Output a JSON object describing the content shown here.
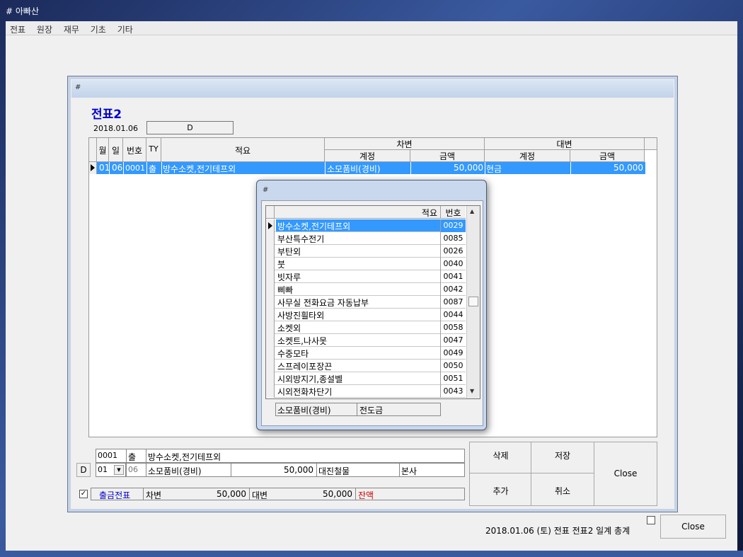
{
  "window": {
    "title": "# 아빠산"
  },
  "menu": [
    "전표",
    "원장",
    "재무",
    "기초",
    "기타"
  ],
  "form": {
    "caption": "#",
    "heading": "전표2",
    "date": "2018.01.06",
    "d_label": "D",
    "grid": {
      "headers": {
        "month": "월",
        "day": "일",
        "number": "번호",
        "type": "TY",
        "memo": "적요",
        "debit": "차변",
        "credit": "대변",
        "debit_account": "계정",
        "debit_amount": "금액",
        "credit_account": "계정",
        "credit_amount": "금액"
      },
      "rows": [
        {
          "month": "01",
          "day": "06",
          "number": "0001",
          "type": "출",
          "memo": "방수소켓,전기테프외",
          "debit_account": "소모품비(경비)",
          "debit_amount": "50,000",
          "credit_account": "현금",
          "credit_amount": "50,000"
        }
      ]
    }
  },
  "popup": {
    "caption": "#",
    "col_memo": "적요",
    "col_number": "번호",
    "items": [
      {
        "memo": "방수소켓,전기테프외",
        "number": "0029"
      },
      {
        "memo": "부산특수전기",
        "number": "0085"
      },
      {
        "memo": "부탄외",
        "number": "0026"
      },
      {
        "memo": "붓",
        "number": "0040"
      },
      {
        "memo": "빗자루",
        "number": "0041"
      },
      {
        "memo": "삐빠",
        "number": "0042"
      },
      {
        "memo": "사무실 전화요금 자동납부",
        "number": "0087"
      },
      {
        "memo": "사방진흴타외",
        "number": "0044"
      },
      {
        "memo": "소켓외",
        "number": "0058"
      },
      {
        "memo": "소켓트,나사못",
        "number": "0047"
      },
      {
        "memo": "수중모타",
        "number": "0049"
      },
      {
        "memo": "스프레이포장끈",
        "number": "0050"
      },
      {
        "memo": "시외방지기,종설벨",
        "number": "0051"
      },
      {
        "memo": "시외전화차단기",
        "number": "0043"
      }
    ],
    "footer_account": "소모품비(경비)",
    "footer_vendor": "전도금"
  },
  "entry": {
    "number": "0001",
    "type": "출",
    "memo": "방수소켓,전기테프외",
    "d_button": "D",
    "month_select": "01",
    "day": "06",
    "account": "소모품비(경비)",
    "amount": "50,000",
    "vendor": "대진철물",
    "branch": "본사",
    "checkbox_mark": "✓",
    "voucher_type": "출금전표",
    "debit_label": "차변",
    "debit_total": "50,000",
    "credit_label": "대변",
    "credit_total": "50,000",
    "balance_label": "잔액"
  },
  "buttons": {
    "delete": "삭제",
    "save": "저장",
    "add": "추가",
    "cancel": "취소",
    "close_form": "Close"
  },
  "status": {
    "summary": "2018.01.06 (토) 전표 전표2 일계 총계",
    "close": "Close"
  },
  "colors": {
    "selection": "#3399ff",
    "heading": "#0000c8",
    "voucher_type": "#0000c8",
    "balance": "#cc0000"
  }
}
